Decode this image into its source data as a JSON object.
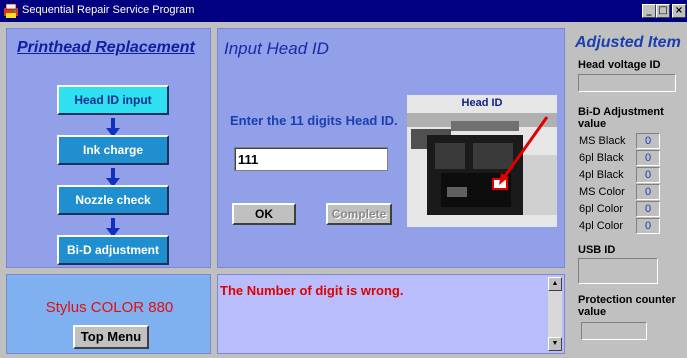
{
  "window": {
    "title": "Sequential Repair Service Program",
    "minimize_glyph": "_",
    "maximize_glyph": "□",
    "close_glyph": "×"
  },
  "left_panel": {
    "title": "Printhead Replacement",
    "steps": [
      {
        "label": "Head ID input",
        "active": true
      },
      {
        "label": "Ink charge",
        "active": false
      },
      {
        "label": "Nozzle check",
        "active": false
      },
      {
        "label": "Bi-D adjustment",
        "active": false
      }
    ]
  },
  "center_panel": {
    "heading": "Input Head ID",
    "prompt": "Enter the 11 digits Head ID.",
    "head_id_value": "111",
    "ok_label": "OK",
    "complete_label": "Complete",
    "photo_label": "Head ID"
  },
  "model_panel": {
    "model_name": "Stylus COLOR 880",
    "top_menu_label": "Top Menu"
  },
  "message_panel": {
    "message": "The Number of digit is wrong."
  },
  "right_panel": {
    "title": "Adjusted Item",
    "head_voltage_label": "Head voltage ID",
    "head_voltage_value": "",
    "bid_label_line1": "Bi-D Adjustment",
    "bid_label_line2": "value",
    "bid_rows": [
      {
        "label": "MS Black",
        "value": "0"
      },
      {
        "label": "6pl Black",
        "value": "0"
      },
      {
        "label": "4pl Black",
        "value": "0"
      },
      {
        "label": "MS Color",
        "value": "0"
      },
      {
        "label": "6pl Color",
        "value": "0"
      },
      {
        "label": "4pl Color",
        "value": "0"
      }
    ],
    "usb_label": "USB ID",
    "usb_value": "",
    "protection_label_line1": "Protection counter",
    "protection_label_line2": "value",
    "protection_value": ""
  },
  "colors": {
    "panel_blue": "#92a0ea",
    "step_blue": "#1f8fd0",
    "step_active": "#2ee0f0",
    "error_red": "#e00000",
    "title_navy": "#000080"
  },
  "icons": {
    "app": "printer-app-icon",
    "arrow": "arrow-down-icon",
    "scroll_up": "scroll-up-icon",
    "scroll_down": "scroll-down-icon"
  }
}
